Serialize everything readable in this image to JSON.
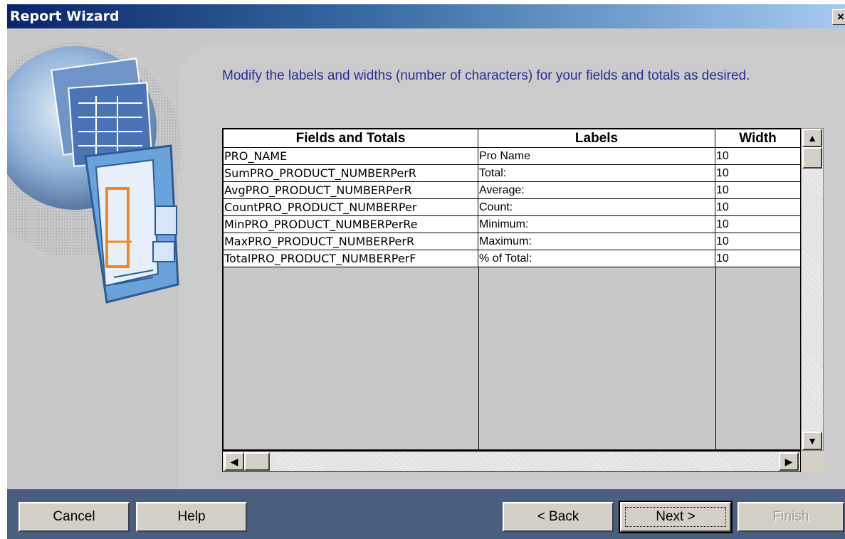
{
  "window": {
    "title": "Report Wizard",
    "close_label": "×"
  },
  "instructions": "Modify the labels and widths (number of characters) for your fields and totals as desired.",
  "table": {
    "headers": [
      "Fields and Totals",
      "Labels",
      "Width"
    ],
    "rows": [
      {
        "field": "PRO_NAME",
        "label": "Pro Name",
        "width": "10"
      },
      {
        "field": "SumPRO_PRODUCT_NUMBERPerR",
        "label": "Total:",
        "width": "10"
      },
      {
        "field": "AvgPRO_PRODUCT_NUMBERPerR",
        "label": "Average:",
        "width": "10"
      },
      {
        "field": "CountPRO_PRODUCT_NUMBERPer",
        "label": "Count:",
        "width": "10"
      },
      {
        "field": "MinPRO_PRODUCT_NUMBERPerRe",
        "label": "Minimum:",
        "width": "10"
      },
      {
        "field": "MaxPRO_PRODUCT_NUMBERPerR",
        "label": "Maximum:",
        "width": "10"
      },
      {
        "field": "TotalPRO_PRODUCT_NUMBERPerF",
        "label": "% of Total:",
        "width": "10"
      }
    ]
  },
  "scroll": {
    "up_arrow": "▲",
    "down_arrow": "▼",
    "left_arrow": "◀",
    "right_arrow": "▶"
  },
  "buttons": {
    "cancel": "Cancel",
    "help": "Help",
    "back": "< Back",
    "next": "Next >",
    "finish": "Finish"
  },
  "icons": {
    "wizard_art": "report-wizard-illustration-icon"
  },
  "colors": {
    "title_bar": "#0a246a",
    "instruction_text": "#2c2c96",
    "footer": "#4a5e80"
  }
}
